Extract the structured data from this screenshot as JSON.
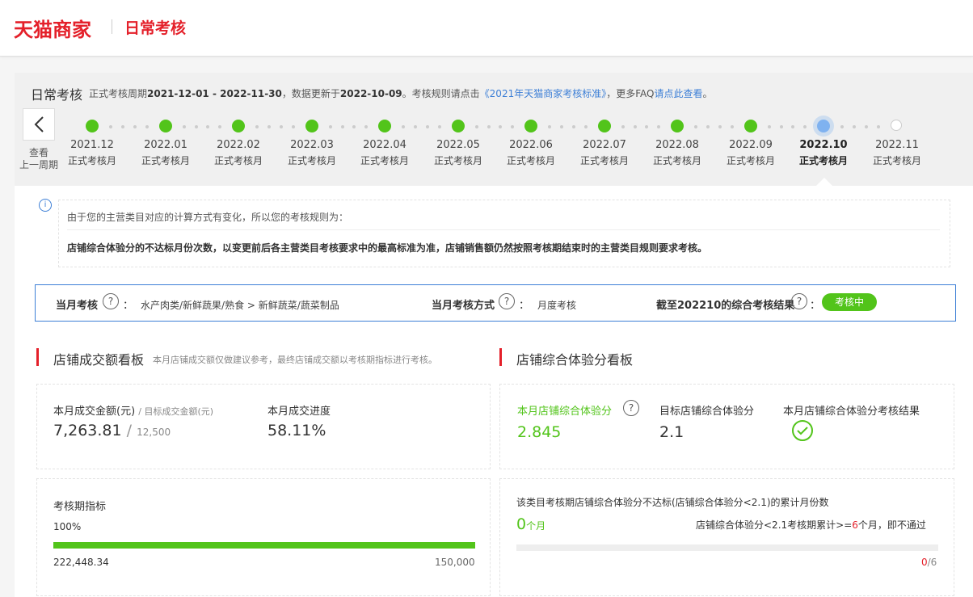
{
  "brand": {
    "logo": "天猫商家",
    "page": "日常考核"
  },
  "header": {
    "title": "日常考核",
    "desc_prefix": "正式考核周期",
    "period": "2021-12-01 - 2022-11-30",
    "desc_mid": "，数据更新于",
    "update_date": "2022-10-09",
    "desc_rule": "。考核规则请点击",
    "rule_link": "《2021年天猫商家考核标准》",
    "desc_faq": "，更多FAQ",
    "faq_link": "请点此查看",
    "desc_end": "。"
  },
  "back": {
    "line1": "查看",
    "line2": "上一周期"
  },
  "timeline": [
    {
      "date": "2021.12",
      "label": "正式考核月",
      "state": "done"
    },
    {
      "date": "2022.01",
      "label": "正式考核月",
      "state": "done"
    },
    {
      "date": "2022.02",
      "label": "正式考核月",
      "state": "done"
    },
    {
      "date": "2022.03",
      "label": "正式考核月",
      "state": "done"
    },
    {
      "date": "2022.04",
      "label": "正式考核月",
      "state": "done"
    },
    {
      "date": "2022.05",
      "label": "正式考核月",
      "state": "done"
    },
    {
      "date": "2022.06",
      "label": "正式考核月",
      "state": "done"
    },
    {
      "date": "2022.07",
      "label": "正式考核月",
      "state": "done"
    },
    {
      "date": "2022.08",
      "label": "正式考核月",
      "state": "done"
    },
    {
      "date": "2022.09",
      "label": "正式考核月",
      "state": "done"
    },
    {
      "date": "2022.10",
      "label": "正式考核月",
      "state": "current"
    },
    {
      "date": "2022.11",
      "label": "正式考核月",
      "state": "future"
    }
  ],
  "notice": {
    "line1": "由于您的主营类目对应的计算方式有变化，所以您的考核规则为：",
    "line2": "店铺综合体验分的不达标月份次数，以变更前后各主营类目考核要求中的最高标准为准，店铺销售额仍然按照考核期结束时的主营类目规则要求考核。"
  },
  "exam": {
    "month_label": "当月考核",
    "category": "水产肉类/新鲜蔬果/熟食 > 新鲜蔬菜/蔬菜制品",
    "method_label": "当月考核方式",
    "method": "月度考核",
    "result_label": "截至202210的综合考核结果",
    "status": "考核中",
    "qmark": "?",
    "colon": "："
  },
  "sales": {
    "title": "店铺成交额看板",
    "note": "本月店铺成交额仅做建议参考，最终店铺成交额以考核期指标进行考核。",
    "amount_label": "本月成交金额(元)",
    "target_label": "/ 目标成交金额(元)",
    "amount": "7,263.81",
    "slash": "/",
    "target": "12,500",
    "progress_label": "本月成交进度",
    "progress": "58.11%",
    "period_label": "考核期指标",
    "period_pct": "100%",
    "period_fill": 1.0,
    "period_value": "222,448.34",
    "period_target": "150,000"
  },
  "exp": {
    "title": "店铺综合体验分看板",
    "score_label": "本月店铺综合体验分",
    "score": "2.845",
    "target_label": "目标店铺综合体验分",
    "target": "2.1",
    "result_label": "本月店铺综合体验分考核结果",
    "fail_text": "该类目考核期店铺综合体验分不达标(店铺综合体验分<2.1)的累计月份数",
    "months_value": "0",
    "months_unit": "个月",
    "rule_prefix": "店铺综合体验分<2.1考核期累计>=",
    "rule_num": "6",
    "rule_suffix": "个月，即不通过",
    "fail_fill": 0,
    "count": "0",
    "total": "/6"
  },
  "colors": {
    "brand_red": "#e4202a",
    "green": "#52c41a",
    "blue": "#3d7fd6"
  }
}
